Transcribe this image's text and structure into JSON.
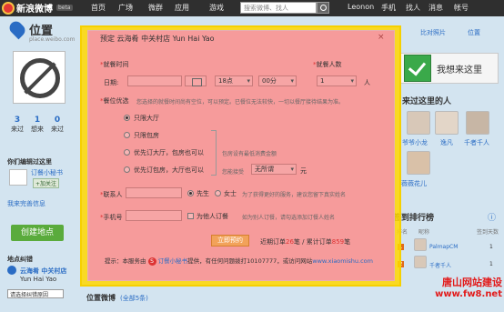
{
  "topbar": {
    "logo": "新浪微博",
    "beta": "beta",
    "nav": [
      "首页",
      "广场",
      "微群",
      "应用",
      "游戏"
    ],
    "search_placeholder": "搜索微博、找人",
    "user": "Leonon",
    "right": [
      "手机",
      "找人",
      "消息",
      "帐号"
    ]
  },
  "location": {
    "title": "位置",
    "subtitle": "place.weibo.com",
    "stats": [
      {
        "num": "3",
        "label": "来过"
      },
      {
        "num": "1",
        "label": "想来"
      },
      {
        "num": "0",
        "label": "来过"
      }
    ],
    "editor_heading": "你们编辑过这里",
    "editor_name": "订餐小秘书",
    "follow_btn": "+加关注",
    "complete_link": "我来完善信息",
    "create_btn": "创建地点",
    "address_heading": "地点纠错",
    "address_line1": "云海肴 中关村店",
    "address_line2": "Yun Hai Yao",
    "select_placeholder": "请选择纠错原因",
    "weibo_heading": "位置微博",
    "weibo_count": "(全部5条)"
  },
  "right": {
    "top_links": [
      "比对照片",
      "位置"
    ],
    "checkin_label": "我想来这里",
    "visitors_heading": "来过这里的人",
    "visitors": [
      "爷爷小龙",
      "逸凡",
      "千者千人",
      "薇薇花儿"
    ],
    "rank_heading": "签到排行榜",
    "rank_cols": [
      "排名",
      "昵称",
      "签到天数"
    ],
    "rank_rows": [
      {
        "rank": "1",
        "name": "PalmapCM",
        "count": "1"
      },
      {
        "rank": "2",
        "name": "千者千人",
        "count": "1"
      }
    ]
  },
  "watermark": {
    "line1": "唐山网站建设",
    "line2": "www.fw8.net"
  },
  "modal": {
    "title": "预定 云海肴 中关村店 Yun Hai Yao",
    "close": "×",
    "time_label": "就餐时间",
    "date_label": "日期:",
    "hour_value": "18点",
    "minute_value": "00分",
    "people_label": "就餐人数",
    "people_value": "1",
    "people_unit": "人",
    "seat_label": "餐位优选",
    "seat_hint": "您选择的就餐时间尚有空位，可以预定。已餐位无法较快，一切以餐厅接待结果为准。",
    "seat_options": [
      "只限大厅",
      "只限包房",
      "优先订大厅，包房也可以",
      "优先订包房，大厅也可以"
    ],
    "room_fee_hint": "包房设有最低消费金额",
    "budget_label": "您能接受",
    "budget_value": "无所谓",
    "budget_unit": "元",
    "contact_label": "联系人",
    "gender_options": [
      "先生",
      "女士"
    ],
    "contact_hint": "为了获得更好的服务，建议您留下真实姓名",
    "phone_label": "手机号",
    "for_others_label": "为他人订餐",
    "phone_hint": "如为别人订餐，请勾选添加订餐人姓名",
    "submit": "立即预约",
    "stats_prefix": "近期订单",
    "recent_count": "26",
    "stats_mid": "笔 / 累计订单",
    "total_count": "859",
    "stats_suffix": "笔",
    "footer_prefix": "提示：本服务由",
    "footer_badge": "S",
    "footer_provider": "订餐小秘书",
    "footer_mid": "提供，有任何问题拨打10107777，或访问网站",
    "footer_site": "www.xiaomishu.com"
  }
}
